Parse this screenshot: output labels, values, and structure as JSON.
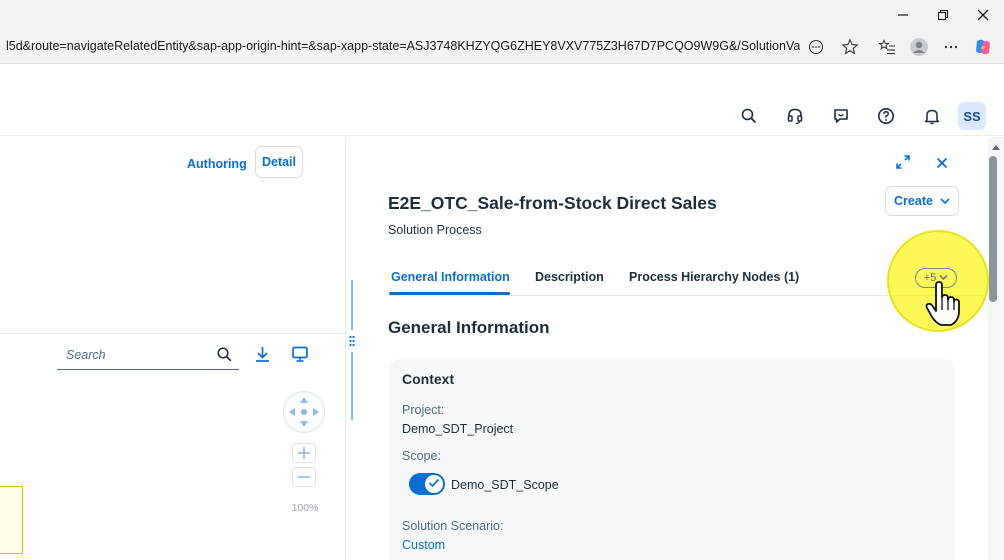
{
  "browser": {
    "url": "l5d&route=navigateRelatedEntity&sap-app-origin-hint=&sap-xapp-state=ASJ3748KHZYQG6ZHEY8VXV775Z3H67D7PCQO9W9G&/SolutionValue...",
    "window_controls": [
      "minimize-icon",
      "restore-icon",
      "close-icon"
    ],
    "toolbar_icons": [
      "reader-icon",
      "favorite-star-icon",
      "favorites-list-icon",
      "profile-icon",
      "more-icon",
      "copilot-icon"
    ]
  },
  "shellbar": {
    "icons": [
      "search-icon",
      "headset-icon",
      "feedback-icon",
      "help-icon",
      "notification-icon"
    ],
    "avatar_initials": "SS"
  },
  "left_panel": {
    "authoring_label": "Authoring",
    "detail_label": "Detail",
    "search_placeholder": "Search",
    "zoom_level": "100%"
  },
  "detail_panel": {
    "title": "E2E_OTC_Sale-from-Stock Direct Sales",
    "subtitle": "Solution Process",
    "create_label": "Create",
    "tabs": [
      {
        "label": "General Information",
        "selected": true
      },
      {
        "label": "Description",
        "selected": false
      },
      {
        "label": "Process Hierarchy Nodes (1)",
        "selected": false
      }
    ],
    "more_tabs_label": "+5",
    "section_title": "General Information",
    "context": {
      "title": "Context",
      "project_label": "Project:",
      "project_value": "Demo_SDT_Project",
      "scope_label": "Scope:",
      "scope_value": "Demo_SDT_Scope",
      "scope_enabled": true,
      "scenario_label": "Solution Scenario:",
      "scenario_value": "Custom"
    }
  },
  "colors": {
    "accent": "#0a6ed1",
    "text": "#1d2d3e",
    "highlight": "#faf628"
  }
}
